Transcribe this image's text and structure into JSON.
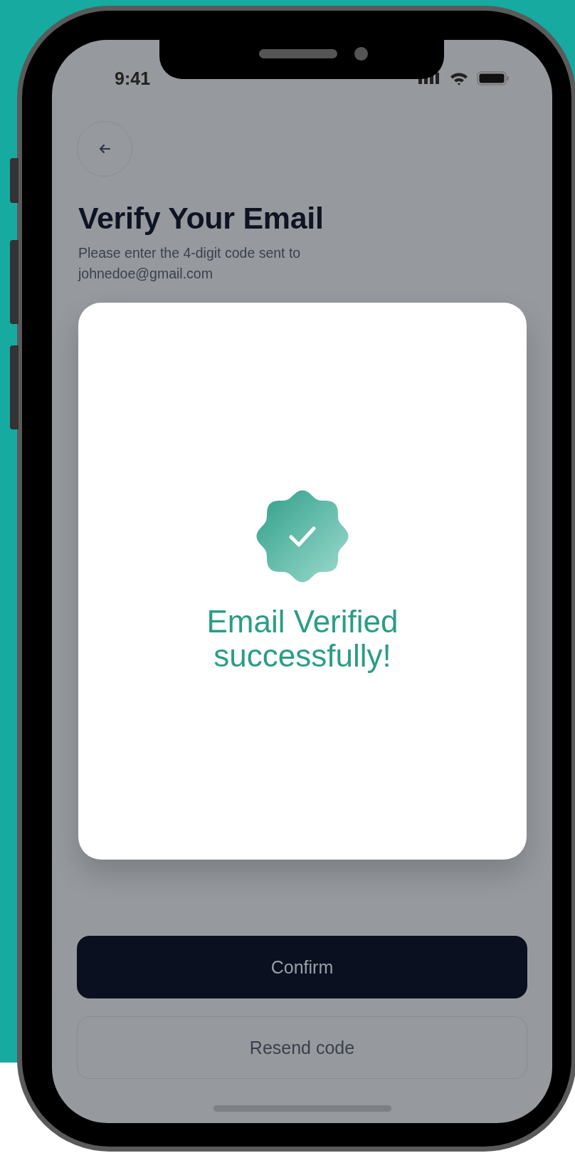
{
  "status_bar": {
    "time": "9:41"
  },
  "header": {
    "title": "Verify Your Email",
    "instruction": "Please enter the 4-digit code sent to",
    "email": "johnedoe@gmail.com"
  },
  "dialog": {
    "message": "Email Verified successfully!"
  },
  "buttons": [
    {
      "label": "Confirm",
      "kind": "primary"
    },
    {
      "label": "Resend code",
      "kind": "secondary"
    }
  ]
}
